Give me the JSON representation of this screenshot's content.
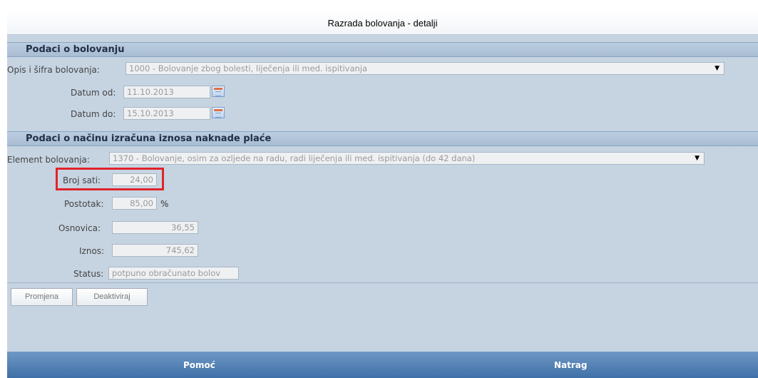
{
  "window": {
    "title": "Razrada bolovanja - detalji"
  },
  "section1": {
    "header": "Podaci o bolovanju",
    "opis_label": "Opis i šifra bolovanja:",
    "opis_value": "1000 - Bolovanje zbog bolesti, liječenja ili med. ispitivanja",
    "datum_od_label": "Datum od:",
    "datum_od_value": "11.10.2013",
    "datum_do_label": "Datum do:",
    "datum_do_value": "15.10.2013"
  },
  "section2": {
    "header": "Podaci o načinu izračuna iznosa naknade plaće",
    "element_label": "Element bolovanja:",
    "element_value": "1370 - Bolovanje, osim za ozljede na radu, radi liječenja ili med. ispitivanja (do 42 dana)",
    "broj_sati_label": "Broj sati:",
    "broj_sati_value": "24,00",
    "postotak_label": "Postotak:",
    "postotak_value": "85,00",
    "postotak_unit": "%",
    "osnovica_label": "Osnovica:",
    "osnovica_value": "36,55",
    "iznos_label": "Iznos:",
    "iznos_value": "745,62",
    "status_label": "Status:",
    "status_value": "potpuno obračunato bolov"
  },
  "actions": {
    "promjena_label": "Promjena",
    "deaktiviraj_label": "Deaktiviraj"
  },
  "footer": {
    "pomoc_label": "Pomoć",
    "natrag_label": "Natrag"
  },
  "colors": {
    "panel_bg": "#c6d4e2",
    "highlight_border": "#e0232b",
    "footer_bg": "#3f70a8"
  }
}
